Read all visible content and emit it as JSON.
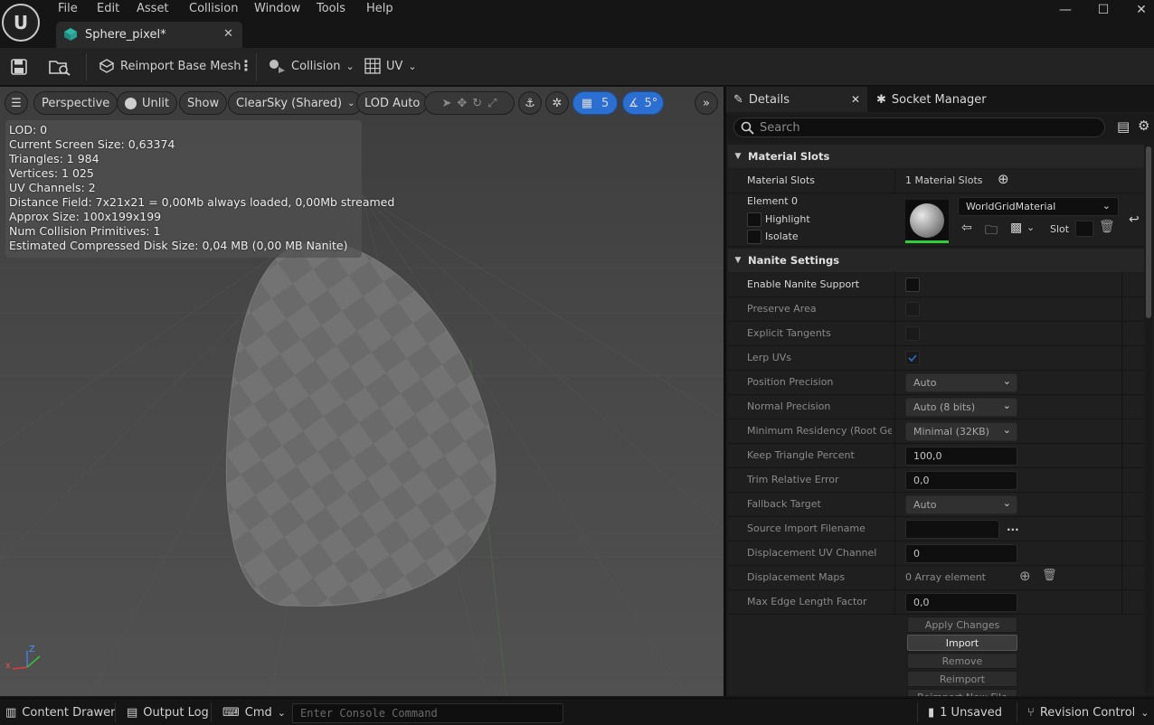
{
  "menu": [
    "File",
    "Edit",
    "Asset",
    "Collision",
    "Window",
    "Tools",
    "Help"
  ],
  "window_controls": {
    "minimize": "—",
    "maximize": "☐",
    "close": "✕"
  },
  "document_tab": {
    "label": "Sphere_pixel*",
    "close": "✕"
  },
  "toolbar": {
    "reimport_label": "Reimport Base Mesh",
    "collision_label": "Collision",
    "uv_label": "UV"
  },
  "viewport": {
    "perspective": "Perspective",
    "unlit": "Unlit",
    "show": "Show",
    "sky": "ClearSky (Shared)",
    "lod": "LOD Auto",
    "grid_snap_value": "5",
    "rotation_snap_value": "5°",
    "stats": [
      "LOD:  0",
      "Current Screen Size:  0,63374",
      "Triangles:  1 984",
      "Vertices:  1 025",
      "UV Channels:  2",
      "Distance Field:  7x21x21 = 0,00Mb always loaded, 0,00Mb streamed",
      "Approx Size: 100x199x199",
      "Num Collision Primitives:  1",
      "Estimated Compressed Disk Size: 0,04 MB (0,00 MB Nanite)"
    ],
    "axis": {
      "z": "Z",
      "x": "x"
    }
  },
  "details_panel": {
    "tab_details": "Details",
    "tab_close": "✕",
    "tab_socket": "Socket Manager",
    "search_placeholder": "Search",
    "material_section": "Material Slots",
    "material_slots_label": "Material Slots",
    "material_slots_value": "1 Material Slots",
    "element_label": "Element 0",
    "highlight_label": "Highlight",
    "isolate_label": "Isolate",
    "material_name": "WorldGridMaterial",
    "slot_label": "Slot",
    "nanite_section": "Nanite Settings",
    "props": {
      "enable_nanite": "Enable Nanite Support",
      "preserve_area": "Preserve Area",
      "explicit_tangents": "Explicit Tangents",
      "lerp_uvs": "Lerp UVs",
      "position_precision": "Position Precision",
      "position_precision_value": "Auto",
      "normal_precision": "Normal Precision",
      "normal_precision_value": "Auto (8 bits)",
      "min_residency": "Minimum Residency (Root Geom",
      "min_residency_value": "Minimal (32KB)",
      "keep_triangle": "Keep Triangle Percent",
      "keep_triangle_value": "100,0",
      "trim_error": "Trim Relative Error",
      "trim_error_value": "0,0",
      "fallback_target": "Fallback Target",
      "fallback_target_value": "Auto",
      "source_import": "Source Import Filename",
      "source_import_more": "...",
      "displacement_uv": "Displacement UV Channel",
      "displacement_uv_value": "0",
      "displacement_maps": "Displacement Maps",
      "displacement_maps_value": "0 Array element",
      "max_edge": "Max Edge Length Factor",
      "max_edge_value": "0,0"
    },
    "buttons": {
      "apply": "Apply Changes",
      "import": "Import",
      "remove": "Remove",
      "reimport": "Reimport",
      "reimport_new": "Reimport New File"
    }
  },
  "statusbar": {
    "content_drawer": "Content Drawer",
    "output_log": "Output Log",
    "cmd": "Cmd",
    "console_placeholder": "Enter Console Command",
    "unsaved": "1 Unsaved",
    "revision": "Revision Control"
  },
  "colors": {
    "accent_blue": "#2a6fd1",
    "background": "#151515",
    "panel": "#1c1c1c",
    "viewport": "#4a4a4a"
  }
}
